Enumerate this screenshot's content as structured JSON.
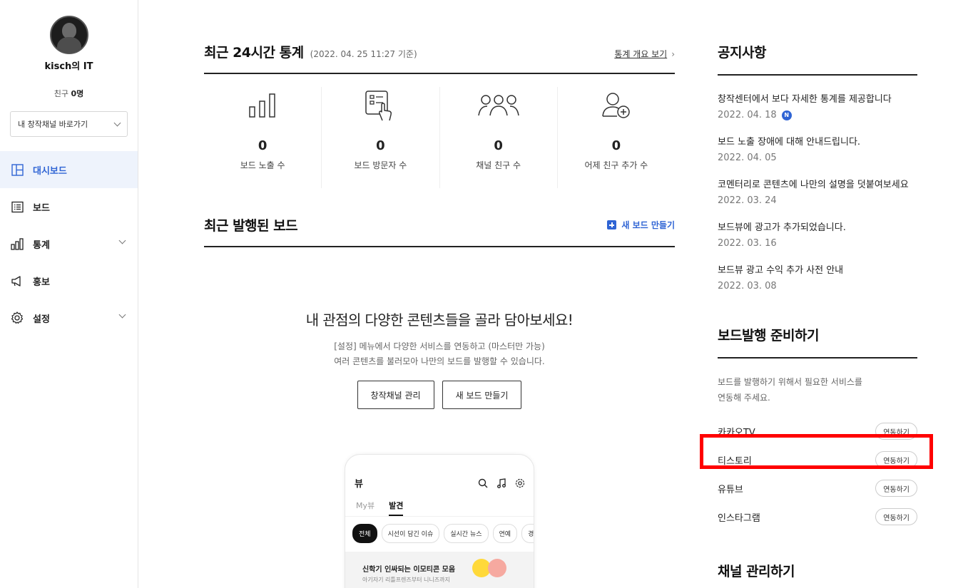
{
  "sidebar": {
    "profile_name": "kisch의 IT",
    "friends_label": "친구",
    "friends_count": "0명",
    "channel_select": "내 창작채널 바로가기",
    "nav": [
      {
        "label": "대시보드",
        "icon": "dashboard-icon",
        "active": true
      },
      {
        "label": "보드",
        "icon": "board-list-icon"
      },
      {
        "label": "통계",
        "icon": "stats-bar-icon",
        "expandable": true
      },
      {
        "label": "홍보",
        "icon": "megaphone-icon"
      },
      {
        "label": "설정",
        "icon": "gear-icon",
        "expandable": true
      }
    ]
  },
  "stats_section": {
    "title": "최근 24시간 통계",
    "subtitle": "(2022. 04. 25 11:27 기준)",
    "link": "통계 개요 보기",
    "items": [
      {
        "value": "0",
        "label": "보드 노출 수",
        "icon": "bar-chart-icon"
      },
      {
        "value": "0",
        "label": "보드 방문자 수",
        "icon": "document-touch-icon"
      },
      {
        "value": "0",
        "label": "채널 친구 수",
        "icon": "group-icon"
      },
      {
        "value": "0",
        "label": "어제 친구 추가 수",
        "icon": "add-user-icon"
      }
    ]
  },
  "board_section": {
    "title": "최근 발행된 보드",
    "new_board_link": "새 보드 만들기",
    "empty_title": "내 관점의 다양한 콘텐츠들을 골라 담아보세요!",
    "empty_desc1": "[설정] 메뉴에서 다양한 서비스를 연동하고 (마스터만 가능)",
    "empty_desc2": "여러 콘텐츠를 불러모아 나만의 보드를 발행할 수 있습니다.",
    "btn_channel": "창작채널 관리",
    "btn_new": "새 보드 만들기"
  },
  "phone": {
    "title": "뷰",
    "tabs": [
      "My뷰",
      "발견"
    ],
    "chips": [
      "전체",
      "시선이 담긴 이슈",
      "실시간 뉴스",
      "연예",
      "경제"
    ],
    "banner_title": "신학기 인싸되는 이모티콘 모음",
    "banner_sub": "아기자기 리틀프렌즈부터 니니즈까지"
  },
  "notices": {
    "title": "공지사항",
    "items": [
      {
        "title": "창작센터에서 보다 자세한 통계를 제공합니다",
        "date": "2022. 04. 18",
        "badge": "N"
      },
      {
        "title": "보드 노출 장애에 대해 안내드립니다.",
        "date": "2022. 04. 05"
      },
      {
        "title": "코멘터리로 콘텐츠에 나만의 설명을 덧붙여보세요",
        "date": "2022. 03. 24"
      },
      {
        "title": "보드뷰에 광고가 추가되었습니다.",
        "date": "2022. 03. 16"
      },
      {
        "title": "보드뷰 광고 수익 추가 사전 안내",
        "date": "2022. 03. 08"
      }
    ]
  },
  "prep": {
    "title": "보드발행 준비하기",
    "desc1": "보드를 발행하기 위해서 필요한 서비스를",
    "desc2": "연동해 주세요.",
    "services": [
      {
        "name": "카카오TV",
        "button": "연동하기"
      },
      {
        "name": "티스토리",
        "button": "연동하기"
      },
      {
        "name": "유튜브",
        "button": "연동하기"
      },
      {
        "name": "인스타그램",
        "button": "연동하기"
      }
    ]
  },
  "channel_manage": {
    "title": "채널 관리하기"
  },
  "colors": {
    "accent": "#2f64d4",
    "highlight": "#ff0000"
  }
}
